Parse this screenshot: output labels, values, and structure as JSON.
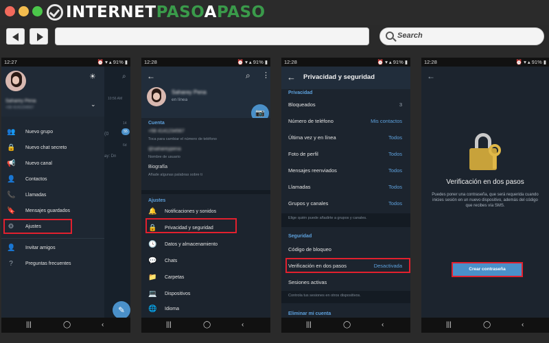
{
  "browser": {
    "logo": {
      "part1": "INTERNET",
      "part2": "PASO",
      "part3": "A",
      "part4": "PASO"
    },
    "search_label": "Search"
  },
  "phone1": {
    "status": {
      "time": "12:27",
      "battery": "91%"
    },
    "drawer": {
      "user_name": "Saharey Pena",
      "user_phone": "+58 4141234567",
      "items": [
        {
          "icon": "group-icon",
          "glyph": "👥",
          "label": "Nuevo grupo"
        },
        {
          "icon": "lock-icon",
          "glyph": "🔒",
          "label": "Nuevo chat secreto"
        },
        {
          "icon": "megaphone-icon",
          "glyph": "📢",
          "label": "Nuevo canal"
        },
        {
          "icon": "contact-icon",
          "glyph": "👤",
          "label": "Contactos"
        },
        {
          "icon": "phone-icon",
          "glyph": "📞",
          "label": "Llamadas"
        },
        {
          "icon": "bookmark-icon",
          "glyph": "🔖",
          "label": "Mensajes guardados"
        },
        {
          "icon": "gear-icon",
          "glyph": "⚙",
          "label": "Ajustes"
        },
        {
          "icon": "add-user-icon",
          "glyph": "➕",
          "label": "Invitar amigos"
        },
        {
          "icon": "help-icon",
          "glyph": "❓",
          "label": "Preguntas frecuentes"
        }
      ]
    },
    "bg_times": [
      "10:56 AM",
      "55",
      "14",
      "6d",
      "Dn"
    ]
  },
  "phone2": {
    "status": {
      "time": "12:28",
      "battery": "91%"
    },
    "profile": {
      "name": "Saharey Pena",
      "status": "en línea"
    },
    "account_header": "Cuenta",
    "phone_value": "+58 4141234567",
    "phone_hint": "Toca para cambiar el número de teléfono",
    "username_value": "@sahareypena",
    "username_hint": "Nombre de usuario",
    "bio_label": "Biografía",
    "bio_hint": "Añade algunas palabras sobre ti",
    "settings_header": "Ajustes",
    "settings_items": [
      {
        "icon": "bell-icon",
        "glyph": "🔔",
        "label": "Notificaciones y sonidos"
      },
      {
        "icon": "lock-icon",
        "glyph": "🔒",
        "label": "Privacidad y seguridad"
      },
      {
        "icon": "clock-icon",
        "glyph": "🕓",
        "label": "Datos y almacenamiento"
      },
      {
        "icon": "chat-icon",
        "glyph": "💬",
        "label": "Chats"
      },
      {
        "icon": "folder-icon",
        "glyph": "📁",
        "label": "Carpetas"
      },
      {
        "icon": "laptop-icon",
        "glyph": "💻",
        "label": "Dispositivos"
      },
      {
        "icon": "globe-icon",
        "glyph": "🌐",
        "label": "Idioma"
      }
    ]
  },
  "phone3": {
    "status": {
      "time": "12:28",
      "battery": "91%"
    },
    "title": "Privacidad y seguridad",
    "privacy_header": "Privacidad",
    "privacy_rows": [
      {
        "label": "Bloqueados",
        "value": "3"
      },
      {
        "label": "Número de teléfono",
        "value": "Mis contactos"
      },
      {
        "label": "Última vez y en línea",
        "value": "Todos"
      },
      {
        "label": "Foto de perfil",
        "value": "Todos"
      },
      {
        "label": "Mensajes reenviados",
        "value": "Todos"
      },
      {
        "label": "Llamadas",
        "value": "Todos"
      },
      {
        "label": "Grupos y canales",
        "value": "Todos"
      }
    ],
    "privacy_hint": "Elige quién puede añadirte a grupos y canales.",
    "security_header": "Seguridad",
    "security_rows": [
      {
        "label": "Código de bloqueo",
        "value": ""
      },
      {
        "label": "Verificación en dos pasos",
        "value": "Desactivada"
      },
      {
        "label": "Sesiones activas",
        "value": ""
      }
    ],
    "security_hint": "Controla tus sesiones en otros dispositivos.",
    "delete_header": "Eliminar mi cuenta"
  },
  "phone4": {
    "status": {
      "time": "12:28",
      "battery": "91%"
    },
    "title": "Verificación en dos pasos",
    "description": "Puedes poner una contraseña, que será requerida cuando inicies sesión en un nuevo dispositivo, además del código que recibes vía SMS.",
    "button_label": "Crear contraseña"
  },
  "colors": {
    "accent": "#5ea2de",
    "highlight": "#e3202e",
    "panel": "#1c242e"
  }
}
